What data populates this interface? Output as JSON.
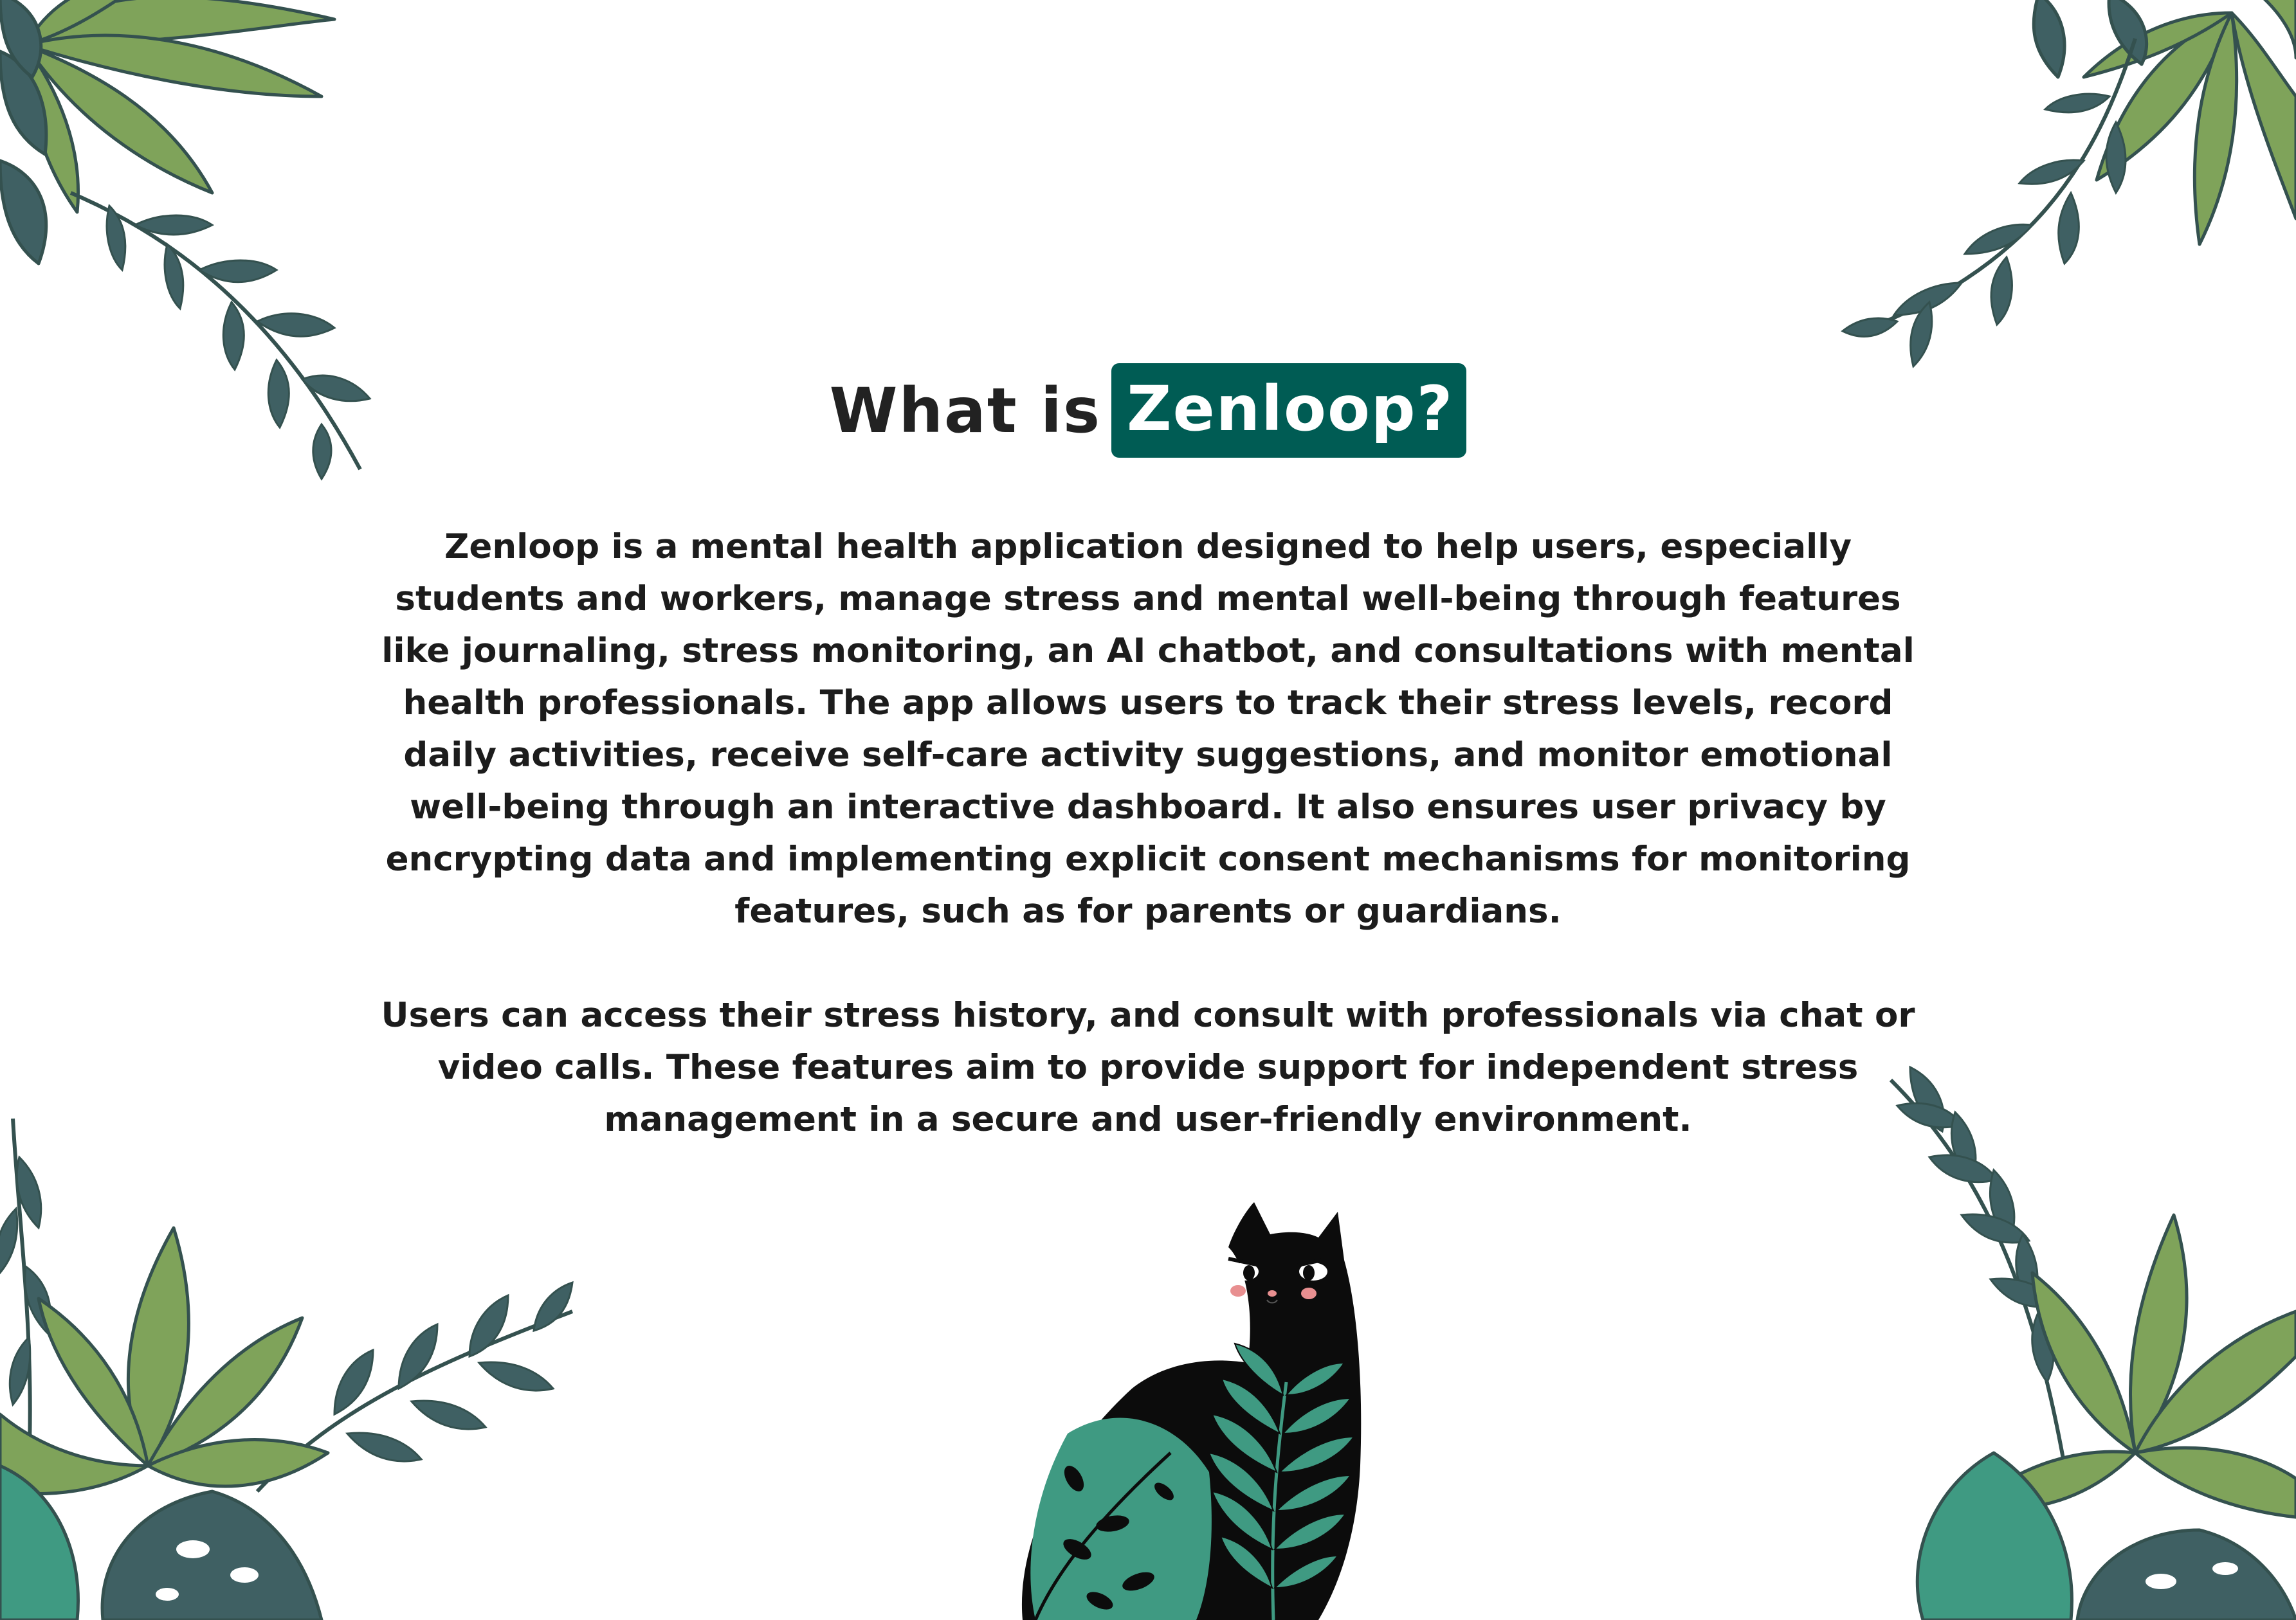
{
  "colors": {
    "accent": "#005c54",
    "leaf_light": "#7fa35a",
    "leaf_dark": "#3f6063",
    "leaf_teal": "#3f9a82",
    "cat_black": "#0c0c0c",
    "text": "#1c1c1c"
  },
  "heading": {
    "lead": "What is",
    "highlight": "Zenloop?"
  },
  "body": {
    "paragraph_1": "Zenloop is a mental health application designed to help users, especially students and workers, manage stress and mental well-being through features like journaling, stress monitoring, an AI chatbot, and consultations with mental health professionals. The app allows users to track their stress levels, record daily activities, receive self-care activity suggestions, and monitor emotional well-being through an interactive dashboard. It also ensures user privacy by encrypting data and implementing explicit consent mechanisms for monitoring features, such as for parents or guardians.",
    "paragraph_2": "Users can access their stress history, and consult with professionals via chat or video calls. These features aim to provide support for independent stress management in a secure and user-friendly environment."
  },
  "decorations": {
    "top_left": "tropical-leaves-illustration",
    "top_right": "tropical-leaves-illustration",
    "bottom_left": "tropical-leaves-illustration",
    "bottom_right": "tropical-leaves-illustration",
    "bottom_center": "black-cat-illustration"
  }
}
